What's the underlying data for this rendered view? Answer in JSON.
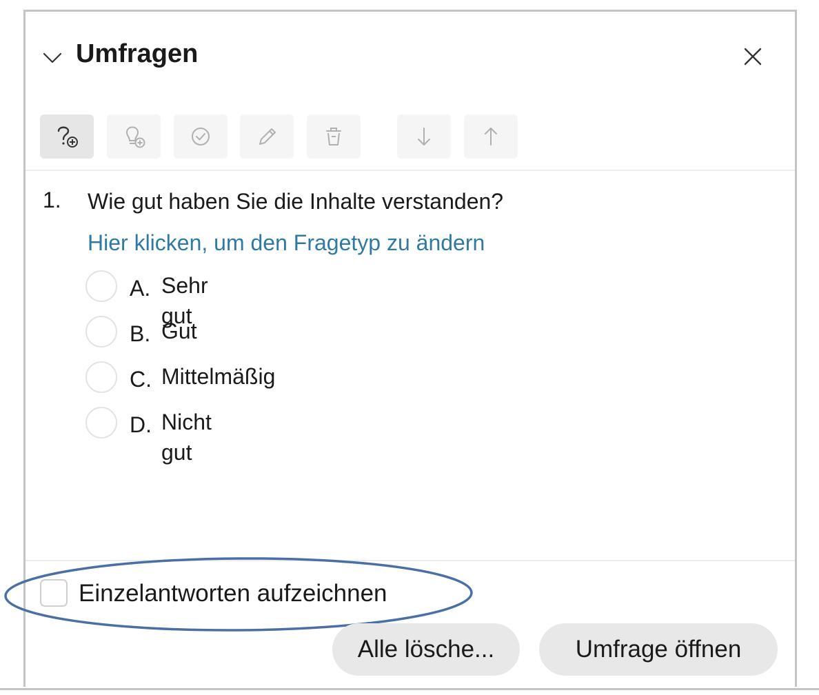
{
  "header": {
    "title": "Umfragen"
  },
  "icons": {
    "collapse": "chevron-down-icon",
    "close": "close-icon",
    "toolbar": [
      "add-question-icon",
      "add-idea-icon",
      "check-circle-icon",
      "pencil-icon",
      "trash-icon",
      "arrow-down-icon",
      "arrow-up-icon"
    ]
  },
  "question": {
    "number": "1.",
    "text": "Wie gut haben Sie die Inhalte verstanden?",
    "change_type_link": "Hier klicken, um den Fragetyp zu ändern",
    "options": [
      {
        "letter": "A.",
        "label": "Sehr gut"
      },
      {
        "letter": "B.",
        "label": "Gut"
      },
      {
        "letter": "C.",
        "label": "Mittelmäßig"
      },
      {
        "letter": "D.",
        "label": "Nicht gut"
      }
    ]
  },
  "footer": {
    "record_answers_label": "Einzelantworten aufzeichnen",
    "record_answers_checked": false,
    "clear_all_label": "Alle lösche...",
    "open_poll_label": "Umfrage öffnen"
  },
  "colors": {
    "link": "#2f7aa3",
    "annotation_ellipse": "#4a6fa5",
    "button_bg": "#e8e8e8"
  }
}
